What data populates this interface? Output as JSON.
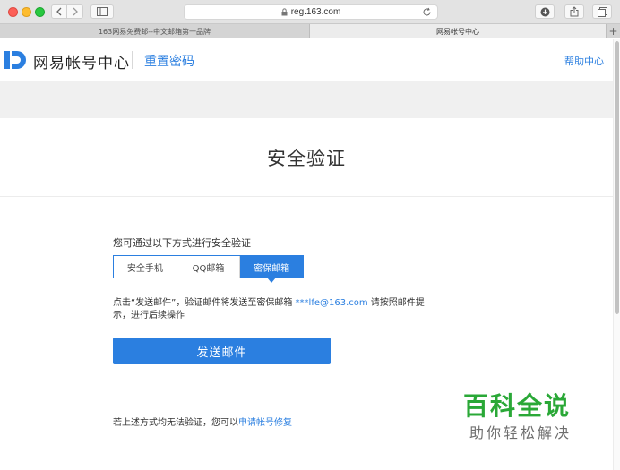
{
  "browser": {
    "url": "reg.163.com",
    "tabs": [
      {
        "label": "163网易免费邮--中文邮箱第一品牌"
      },
      {
        "label": "网易帐号中心"
      }
    ],
    "new_tab": "+"
  },
  "header": {
    "brand": "网易帐号中心",
    "page_name": "重置密码",
    "help": "帮助中心"
  },
  "main": {
    "title": "安全验证",
    "intro": "您可通过以下方式进行安全验证",
    "methods": [
      {
        "label": "安全手机"
      },
      {
        "label": "QQ邮箱"
      },
      {
        "label": "密保邮箱"
      }
    ],
    "desc_prefix": "点击“发送邮件”，验证邮件将发送至密保邮箱 ",
    "email": "***lfe@163.com",
    "desc_suffix": " 请按照邮件提示，进行后续操作",
    "send_button": "发送邮件",
    "footnote_prefix": "若上述方式均无法验证，您可以",
    "footnote_link": "申请帐号修复"
  },
  "watermark": {
    "title": "百科全说",
    "subtitle": "助你轻松解决"
  },
  "colors": {
    "accent": "#2b7fe0",
    "watermark_green": "#2aa837"
  }
}
